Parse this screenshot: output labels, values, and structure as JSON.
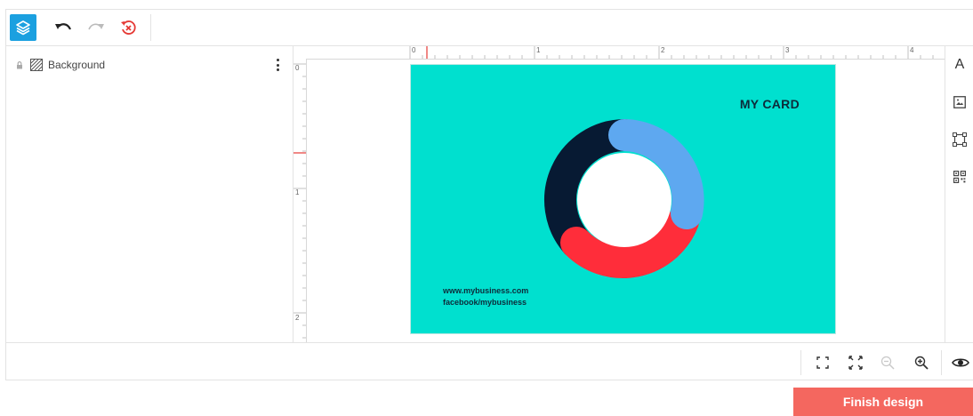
{
  "toolbar": {
    "buttons": [
      {
        "name": "layers-button",
        "icon": "layers-icon"
      },
      {
        "name": "undo-button",
        "icon": "undo-icon"
      },
      {
        "name": "redo-button",
        "icon": "redo-icon"
      },
      {
        "name": "reset-history-button",
        "icon": "history-reset-icon"
      }
    ],
    "active_color": "#1ba0e0"
  },
  "layers": {
    "items": [
      {
        "label": "Background",
        "locked": true,
        "icon": "background-layer-icon"
      }
    ]
  },
  "rulers": {
    "top_labels": [
      "0",
      "1",
      "2",
      "3",
      "4"
    ],
    "left_labels": [
      "0",
      "1",
      "2"
    ]
  },
  "card": {
    "title": "MY CARD",
    "line1": "www.mybusiness.com",
    "line2": "facebook/mybusiness",
    "background": "#00e0cf",
    "donut_colors": [
      "#5ea8f0",
      "#ff2d3a",
      "#071a33"
    ]
  },
  "right_tools": [
    {
      "name": "text-tool-button",
      "icon": "text-icon",
      "glyph": "A"
    },
    {
      "name": "image-tool-button",
      "icon": "image-icon"
    },
    {
      "name": "shape-tool-button",
      "icon": "shape-icon"
    },
    {
      "name": "qr-tool-button",
      "icon": "qr-code-icon"
    }
  ],
  "bottom_tools": [
    {
      "name": "fit-screen-button",
      "icon": "fit-screen-icon"
    },
    {
      "name": "fullscreen-button",
      "icon": "fullscreen-icon"
    },
    {
      "name": "zoom-out-button",
      "icon": "zoom-out-icon"
    },
    {
      "name": "zoom-in-button",
      "icon": "zoom-in-icon"
    },
    {
      "name": "preview-button",
      "icon": "eye-icon"
    }
  ],
  "finish_label": "Finish design",
  "finish_color": "#f4675f"
}
